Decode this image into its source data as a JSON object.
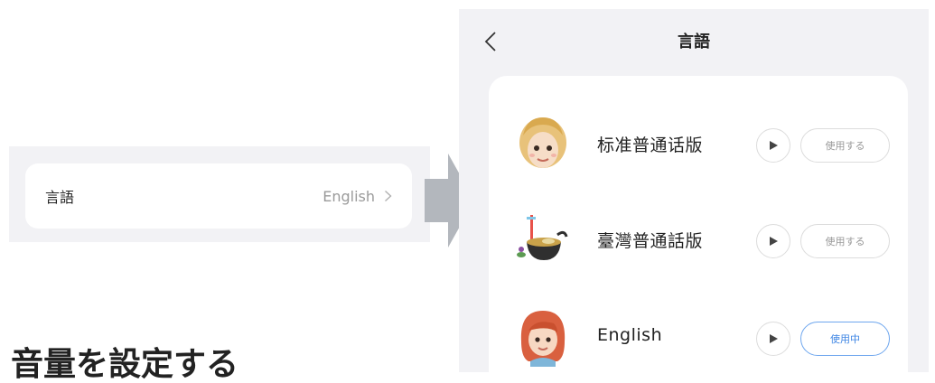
{
  "settings_row": {
    "label": "言語",
    "value": "English"
  },
  "heading": "音量を設定する",
  "screen": {
    "title": "言語",
    "options": [
      {
        "name": "标准普通话版",
        "button": "使用する",
        "active": false,
        "avatar": "blonde-girl-avatar"
      },
      {
        "name": "臺灣普通話版",
        "button": "使用する",
        "active": false,
        "avatar": "noodle-bowl-avatar"
      },
      {
        "name": "English",
        "button": "使用中",
        "active": true,
        "avatar": "redhead-girl-avatar"
      }
    ]
  },
  "colors": {
    "panel_bg": "#f2f2f5",
    "active_border": "#6ea6ee",
    "active_text": "#3f86e4",
    "arrow": "#b3b7bd"
  }
}
